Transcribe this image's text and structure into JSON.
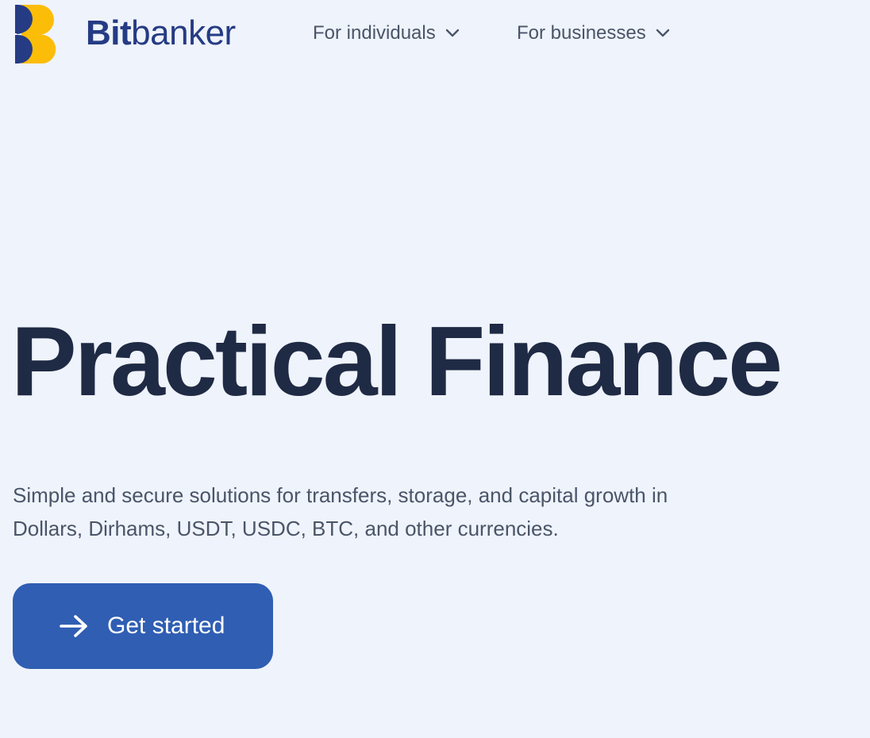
{
  "brand": {
    "name_bold": "Bit",
    "name_regular": "banker",
    "colors": {
      "navy": "#253b84",
      "yellow": "#fbbd08"
    },
    "logo_icon": "bitbanker-logo-icon"
  },
  "nav": {
    "items": [
      {
        "label": "For individuals",
        "icon": "chevron-down-icon"
      },
      {
        "label": "For businesses",
        "icon": "chevron-down-icon"
      }
    ]
  },
  "hero": {
    "title": "Practical Finance",
    "subtitle": "Simple and secure solutions for transfers, storage, and capital growth in Dollars, Dirhams, USDT, USDC, BTC, and other currencies.",
    "cta": {
      "label": "Get started",
      "icon": "arrow-right-icon"
    }
  },
  "colors": {
    "background": "#eff3fb",
    "heading": "#1f2a44",
    "body_text": "#4a5568",
    "cta_bg": "#2f5eb3",
    "cta_text": "#ffffff"
  }
}
